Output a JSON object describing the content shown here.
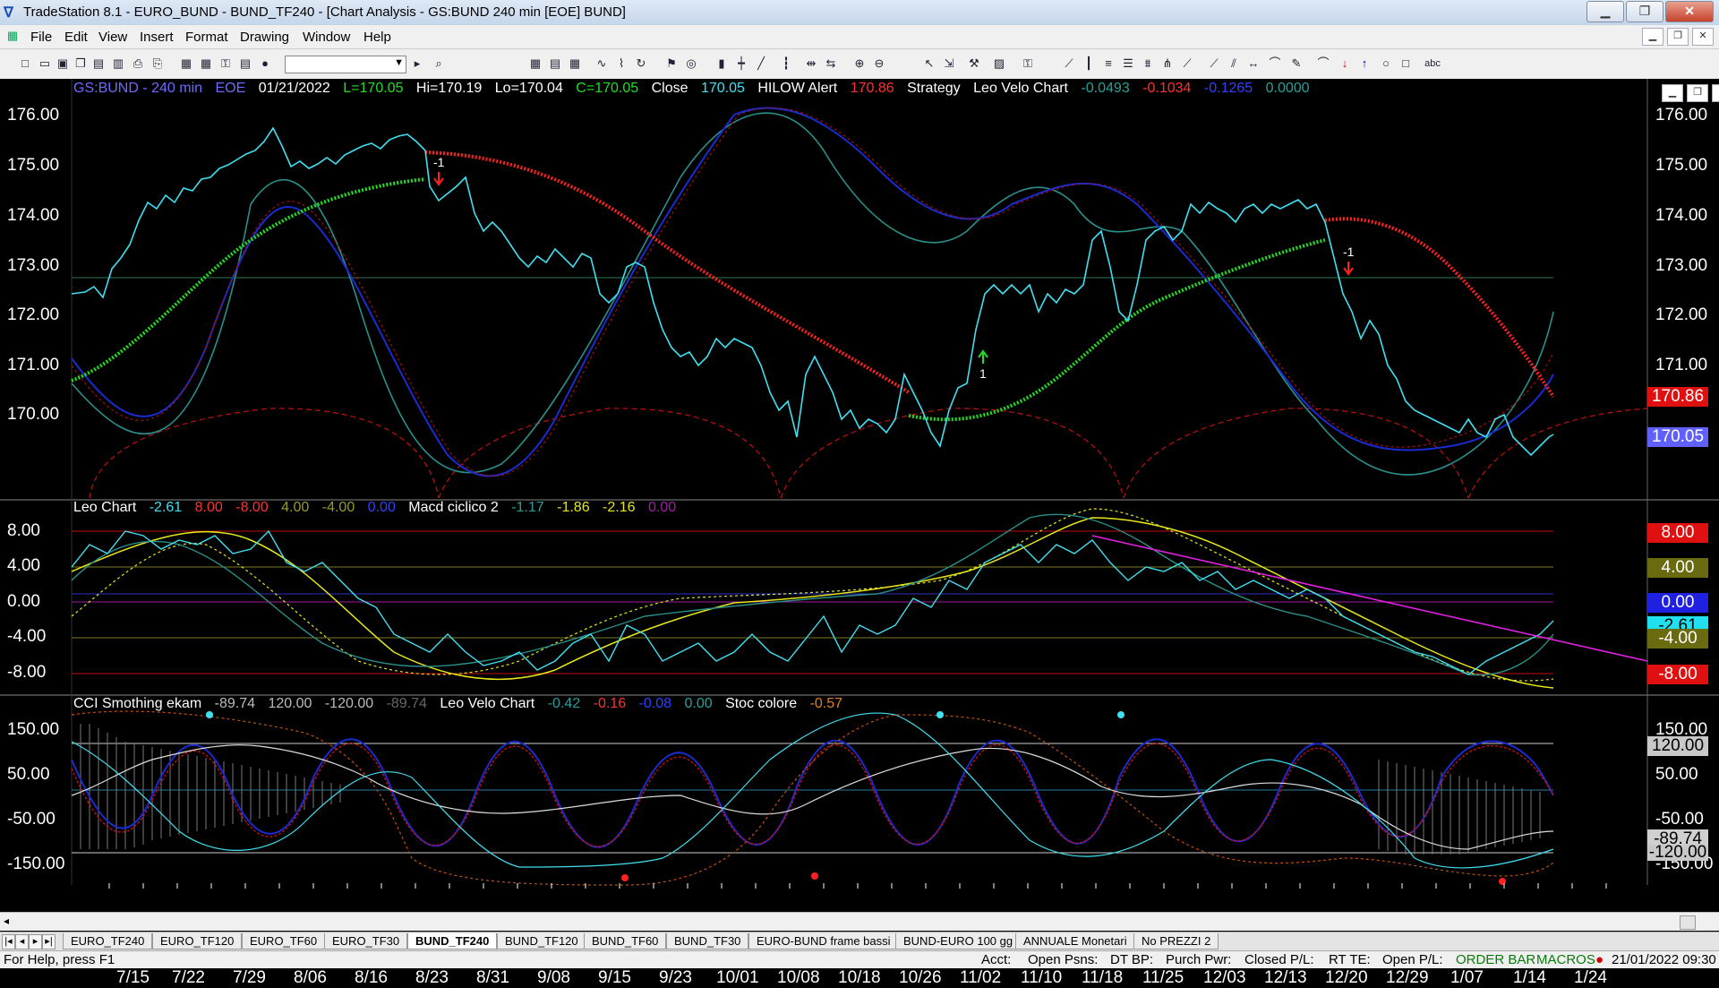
{
  "window": {
    "title": "TradeStation 8.1 - EURO_BUND - BUND_TF240 - [Chart Analysis - GS:BUND  240 min  [EOE] BUND]",
    "min": "▁",
    "max": "❐",
    "close": "✕"
  },
  "menu": [
    "File",
    "Edit",
    "View",
    "Insert",
    "Format",
    "Drawing",
    "Window",
    "Help"
  ],
  "mdi": {
    "min": "▁",
    "restore": "❐",
    "close": "✕"
  },
  "toolbar_icons": [
    "new-icon",
    "open-icon",
    "save-icon",
    "print-icon",
    "cut-icon",
    "copy-icon",
    "paste-icon",
    "lock-icon",
    "chart-icon",
    "radar-icon",
    "zoom-in-icon",
    "zoom-out-icon",
    "pointer-icon",
    "line-icon",
    "arrow-up-icon",
    "arrow-down-icon",
    "circle-icon",
    "rect-icon",
    "text-icon"
  ],
  "price_pane": {
    "symbol": "GS:BUND - 240 min",
    "session": "EOE",
    "date": "01/21/2022",
    "last": "L=170.05",
    "high": "Hi=170.19",
    "low": "Lo=170.04",
    "close_val": "C=170.05",
    "close_label": "Close",
    "close_num": "170.05",
    "hilow": "HILOW Alert",
    "hilow_val": "170.86",
    "strategy": "Strategy",
    "leo_velo": "Leo Velo Chart",
    "lv1": "-0.0493",
    "lv2": "-0.1034",
    "lv3": "-0.1265",
    "lv4": "0.0000",
    "axis": [
      "176.00",
      "175.00",
      "174.00",
      "173.00",
      "172.00",
      "171.00",
      "170.00"
    ],
    "tag_red": "170.86",
    "tag_blue": "170.05",
    "signal_1": "-1",
    "signal_2": "1",
    "signal_3": "-1"
  },
  "macd_pane": {
    "name": "Leo Chart",
    "v1": "-2.61",
    "v2": "8.00",
    "v3": "-8.00",
    "v4": "4.00",
    "v5": "-4.00",
    "v6": "0.00",
    "name2": "Macd ciclico 2",
    "m1": "-1.17",
    "m2": "-1.86",
    "m3": "-2.16",
    "m4": "0.00",
    "axis": [
      "8.00",
      "4.00",
      "0.00",
      "-4.00",
      "-8.00"
    ],
    "tags": [
      "8.00",
      "4.00",
      "0.00",
      "-2.61",
      "-4.00",
      "-8.00"
    ]
  },
  "cci_pane": {
    "name": "CCI Smothing ekam",
    "c1": "-89.74",
    "c2": "120.00",
    "c3": "-120.00",
    "c4": "-89.74",
    "name2": "Leo Velo Chart",
    "l1": "-0.42",
    "l2": "-0.16",
    "l3": "-0.08",
    "l4": "0.00",
    "name3": "Stoc colore",
    "s1": "-0.57",
    "axis": [
      "150.00",
      "50.00",
      "-50.00",
      "-150.00"
    ],
    "raxis": [
      "150.00",
      "50.00",
      "-50.00",
      "-150.00"
    ],
    "tags": [
      "120.00",
      "-89.74",
      "-120.00"
    ]
  },
  "dates": [
    "7/15",
    "7/22",
    "7/29",
    "8/06",
    "8/16",
    "8/23",
    "8/31",
    "9/08",
    "9/15",
    "9/23",
    "10/01",
    "10/08",
    "10/18",
    "10/26",
    "11/02",
    "11/10",
    "11/18",
    "11/25",
    "12/03",
    "12/13",
    "12/20",
    "12/29",
    "1/07",
    "1/14",
    "1/24"
  ],
  "tabs": [
    "EURO_TF240",
    "EURO_TF120",
    "EURO_TF60",
    "EURO_TF30",
    "BUND_TF240",
    "BUND_TF120",
    "BUND_TF60",
    "BUND_TF30",
    "EURO-BUND frame bassi",
    "BUND-EURO 100 gg",
    "ANNUALE Monetari",
    "No PREZZI 2"
  ],
  "status": {
    "help": "For Help, press F1",
    "acct": "Acct:",
    "open_psns": "Open Psns:",
    "dtbp": "DT BP:",
    "purch": "Purch Pwr:",
    "closed": "Closed P/L:",
    "rtte": "RT TE:",
    "openpl": "Open P/L:",
    "orderbar": "ORDER BAR",
    "macros": "MACROS",
    "datetime": "21/01/2022 09:30"
  },
  "colors": {
    "up_dots": "#22dd22",
    "down_dots": "#ff2020",
    "price": "#40e0f0",
    "blue_line": "#1a2bd0",
    "teal_line": "#2a8f8a",
    "darkred_line": "#a01010",
    "yellow": "#e6e61a",
    "magenta": "#e020e0"
  }
}
